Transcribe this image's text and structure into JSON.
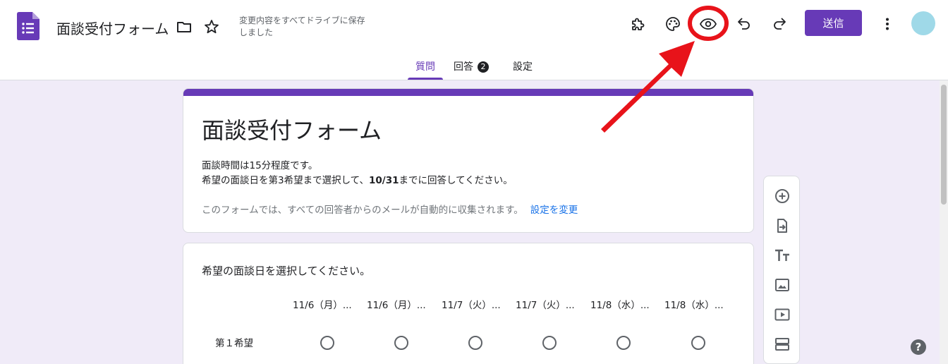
{
  "header": {
    "title": "面談受付フォーム",
    "save_status": "変更内容をすべてドライブに保存しました",
    "send_label": "送信"
  },
  "tabs": [
    {
      "label": "質問",
      "active": true
    },
    {
      "label": "回答",
      "badge": "2"
    },
    {
      "label": "設定"
    }
  ],
  "form": {
    "title": "面談受付フォーム",
    "desc_line1": "面談時間は15分程度です。",
    "desc_line2_pre": "希望の面談日を第3希望まで選択して、",
    "desc_line2_bold": "10/31",
    "desc_line2_post": "までに回答してください。",
    "email_note": "このフォームでは、すべての回答者からのメールが自動的に収集されます。",
    "email_link": "設定を変更"
  },
  "question": {
    "title": "希望の面談日を選択してください。",
    "columns": [
      "11/6（月）...",
      "11/6（月）...",
      "11/7（火）...",
      "11/7（火）...",
      "11/8（水）...",
      "11/8（水）..."
    ],
    "rows": [
      "第１希望"
    ]
  },
  "icons": {
    "app": "forms-icon",
    "toolbar": [
      "addon-icon",
      "palette-icon",
      "preview-eye-icon",
      "undo-icon",
      "redo-icon",
      "more-vert-icon"
    ],
    "side": [
      "add-question-icon",
      "import-questions-icon",
      "add-title-icon",
      "add-image-icon",
      "add-video-icon",
      "add-section-icon"
    ]
  },
  "colors": {
    "brand": "#673ab7",
    "background": "#f0ebf8",
    "link": "#1a73e8",
    "annotation": "#e8131a"
  }
}
